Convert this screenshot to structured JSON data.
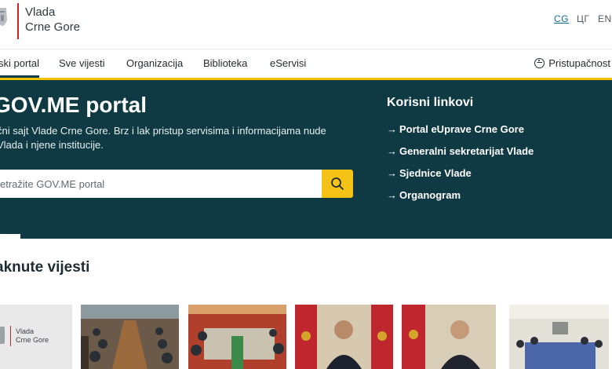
{
  "header": {
    "logo_line1": "Vlada",
    "logo_line2": "Crne Gore",
    "languages": [
      {
        "code": "CG",
        "active": true
      },
      {
        "code": "ЦГ",
        "active": false
      },
      {
        "code": "EN",
        "active": false
      }
    ]
  },
  "nav": {
    "items": [
      {
        "label": "ski portal",
        "active": true
      },
      {
        "label": "Sve vijesti",
        "active": false
      },
      {
        "label": "Organizacija",
        "active": false
      },
      {
        "label": "Biblioteka",
        "active": false
      },
      {
        "label": "eServisi",
        "active": false
      }
    ],
    "accessibility_label": "Pristupačnost"
  },
  "hero": {
    "title": "GOV.ME portal",
    "description": "čni sajt Vlade Crne Gore. Brz i lak pristup servisima i informacijama nude Vlada i njene institucije.",
    "search_placeholder": "etražite GOV.ME portal",
    "links_title": "Korisni linkovi",
    "links": [
      "Portal eUprave Crne Gore",
      "Generalni sekretarijat Vlade",
      "Sjednice Vlade",
      "Organogram"
    ]
  },
  "featured": {
    "title": "aknute vijesti",
    "cards": [
      {
        "kind": "logo",
        "logo_line1": "Vlada",
        "logo_line2": "Crne Gore"
      },
      {
        "kind": "photo",
        "icon": "conference-table-photo"
      },
      {
        "kind": "photo",
        "icon": "meeting-room-photo"
      },
      {
        "kind": "photo",
        "icon": "official-portrait-photo"
      },
      {
        "kind": "photo",
        "icon": "official-portrait-photo"
      },
      {
        "kind": "photo",
        "icon": "reception-hall-photo"
      }
    ]
  },
  "colors": {
    "hero_bg": "#0f3a44",
    "accent_yellow": "#f2c200",
    "brand_red": "#c62828",
    "link_active": "#0d6f8e"
  }
}
